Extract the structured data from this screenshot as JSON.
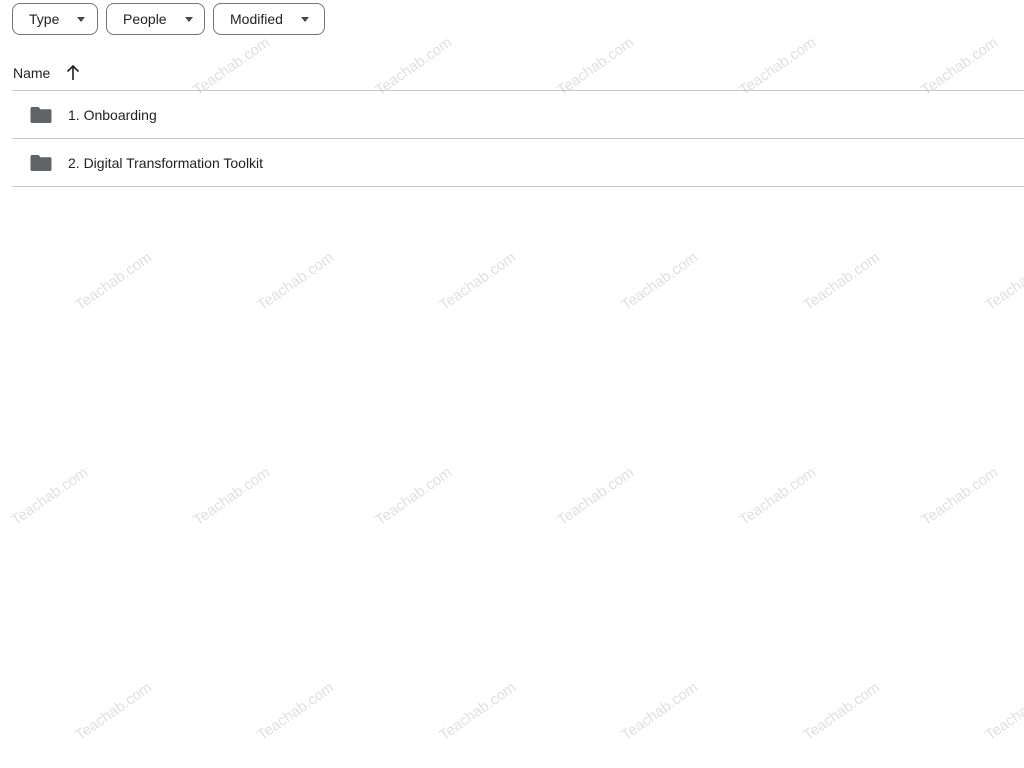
{
  "filters": [
    {
      "label": "Type"
    },
    {
      "label": "People"
    },
    {
      "label": "Modified"
    }
  ],
  "header": {
    "name_label": "Name",
    "sort_icon": "arrow-up-icon"
  },
  "items": [
    {
      "name": "1. Onboarding",
      "icon": "folder-icon"
    },
    {
      "name": "2. Digital Transformation Toolkit",
      "icon": "folder-icon"
    }
  ],
  "watermark": {
    "text": "Teachab.com"
  },
  "colors": {
    "border": "#c7c7c7",
    "chip_border": "#747775",
    "folder": "#5f6368",
    "text": "#1f1f1f"
  }
}
